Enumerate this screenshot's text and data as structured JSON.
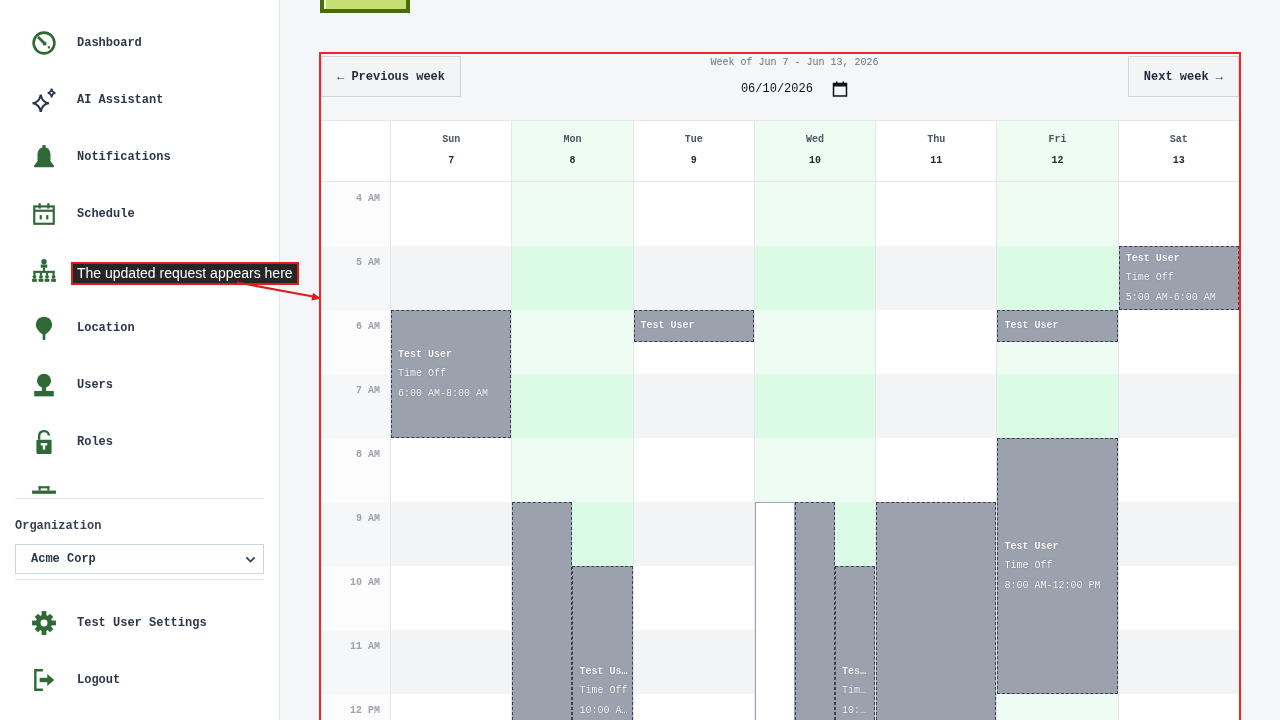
{
  "sidebar": {
    "items": [
      {
        "kind": "link",
        "label": "Dashboard"
      },
      {
        "kind": "link",
        "label": "AI Assistant"
      },
      {
        "kind": "link",
        "label": "Notifications"
      },
      {
        "kind": "link",
        "label": "Schedule"
      },
      {
        "kind": "covered"
      },
      {
        "kind": "link",
        "label": "Location"
      },
      {
        "kind": "link",
        "label": "Users"
      },
      {
        "kind": "link",
        "label": "Roles"
      },
      {
        "kind": "clipped"
      }
    ],
    "organization": {
      "label": "Organization",
      "value": "Acme Corp"
    },
    "footer_items": [
      {
        "label": "Test User Settings"
      },
      {
        "label": "Logout"
      }
    ]
  },
  "calendar": {
    "prev_button": "← Previous week",
    "title": "Week of Jun 7 - Jun 13, 2026",
    "date": "06/10/2026",
    "next_button": "Next week →",
    "hours": [
      "4 AM",
      "5 AM",
      "6 AM",
      "7 AM",
      "8 AM",
      "9 AM",
      "10 AM",
      "11 AM",
      "12 PM"
    ],
    "days": [
      {
        "name": "Sun",
        "number": "7",
        "available": false,
        "lanes": [
          [
            {
              "kind": "free"
            },
            {
              "kind": "free"
            },
            {
              "kind": "free"
            },
            {
              "kind": "free"
            },
            {
              "kind": "time_off",
              "name": "Test User",
              "type": "Time Off",
              "time": "6:00 AM-8:00 AM"
            },
            {
              "kind": "time_off"
            },
            {
              "kind": "time_off"
            },
            {
              "kind": "time_off"
            }
          ]
        ]
      },
      {
        "name": "Mon",
        "number": "8",
        "available": true,
        "lanes": [
          [
            {
              "kind": "free"
            },
            {
              "kind": "free"
            },
            {
              "kind": "free"
            },
            {
              "kind": "free"
            },
            {
              "kind": "free"
            },
            {
              "kind": "free"
            },
            {
              "kind": "free"
            },
            {
              "kind": "free"
            },
            {
              "kind": "free"
            },
            {
              "kind": "free"
            },
            {
              "kind": "time_off"
            },
            {
              "kind": "time_off"
            },
            {
              "kind": "time_off"
            },
            {
              "kind": "time_off"
            },
            {
              "kind": "time_off"
            },
            {
              "kind": "time_off"
            },
            {
              "kind": "time_off"
            }
          ],
          [
            {
              "kind": "free"
            },
            {
              "kind": "free"
            },
            {
              "kind": "free"
            },
            {
              "kind": "free"
            },
            {
              "kind": "free"
            },
            {
              "kind": "free"
            },
            {
              "kind": "free"
            },
            {
              "kind": "free"
            },
            {
              "kind": "free"
            },
            {
              "kind": "free"
            },
            {
              "kind": "free"
            },
            {
              "kind": "free"
            },
            {
              "kind": "time_off",
              "name": "Test Us…",
              "type": "Time Off",
              "time": "10:00 A…"
            },
            {
              "kind": "time_off"
            },
            {
              "kind": "time_off"
            },
            {
              "kind": "time_off"
            },
            {
              "kind": "time_off"
            }
          ]
        ]
      },
      {
        "name": "Tue",
        "number": "9",
        "available": false,
        "lanes": [
          [
            {
              "kind": "free"
            },
            {
              "kind": "free"
            },
            {
              "kind": "free"
            },
            {
              "kind": "free"
            },
            {
              "kind": "time_off",
              "name": "Test User"
            }
          ]
        ]
      },
      {
        "name": "Wed",
        "number": "10",
        "available": true,
        "lanes": [
          [
            {
              "kind": "free"
            },
            {
              "kind": "free"
            },
            {
              "kind": "free"
            },
            {
              "kind": "free"
            },
            {
              "kind": "free"
            },
            {
              "kind": "free"
            },
            {
              "kind": "free"
            },
            {
              "kind": "free"
            },
            {
              "kind": "free"
            },
            {
              "kind": "free"
            },
            {
              "kind": "outline"
            },
            {
              "kind": "outline"
            },
            {
              "kind": "outline"
            },
            {
              "kind": "outline"
            },
            {
              "kind": "outline"
            },
            {
              "kind": "outline"
            },
            {
              "kind": "outline"
            }
          ],
          [
            {
              "kind": "free"
            },
            {
              "kind": "free"
            },
            {
              "kind": "free"
            },
            {
              "kind": "free"
            },
            {
              "kind": "free"
            },
            {
              "kind": "free"
            },
            {
              "kind": "free"
            },
            {
              "kind": "free"
            },
            {
              "kind": "free"
            },
            {
              "kind": "free"
            },
            {
              "kind": "time_off"
            },
            {
              "kind": "time_off"
            },
            {
              "kind": "time_off"
            },
            {
              "kind": "time_off"
            },
            {
              "kind": "time_off"
            },
            {
              "kind": "time_off"
            },
            {
              "kind": "time_off"
            }
          ],
          [
            {
              "kind": "free"
            },
            {
              "kind": "free"
            },
            {
              "kind": "free"
            },
            {
              "kind": "free"
            },
            {
              "kind": "free"
            },
            {
              "kind": "free"
            },
            {
              "kind": "free"
            },
            {
              "kind": "free"
            },
            {
              "kind": "free"
            },
            {
              "kind": "free"
            },
            {
              "kind": "free"
            },
            {
              "kind": "free"
            },
            {
              "kind": "time_off",
              "name": "Tes…",
              "type": "Tim…",
              "time": "10:…"
            },
            {
              "kind": "time_off"
            },
            {
              "kind": "time_off"
            },
            {
              "kind": "time_off"
            },
            {
              "kind": "time_off"
            }
          ]
        ]
      },
      {
        "name": "Thu",
        "number": "11",
        "available": false,
        "lanes": [
          [
            {
              "kind": "free"
            },
            {
              "kind": "free"
            },
            {
              "kind": "free"
            },
            {
              "kind": "free"
            },
            {
              "kind": "free"
            },
            {
              "kind": "free"
            },
            {
              "kind": "free"
            },
            {
              "kind": "free"
            },
            {
              "kind": "free"
            },
            {
              "kind": "free"
            },
            {
              "kind": "time_off"
            },
            {
              "kind": "time_off"
            },
            {
              "kind": "time_off"
            },
            {
              "kind": "time_off"
            },
            {
              "kind": "time_off"
            },
            {
              "kind": "time_off"
            },
            {
              "kind": "time_off"
            }
          ]
        ]
      },
      {
        "name": "Fri",
        "number": "12",
        "available": true,
        "lanes": [
          [
            {
              "kind": "free"
            },
            {
              "kind": "free"
            },
            {
              "kind": "free"
            },
            {
              "kind": "free"
            },
            {
              "kind": "time_off",
              "name": "Test User"
            },
            {
              "kind": "free"
            },
            {
              "kind": "free"
            },
            {
              "kind": "free"
            },
            {
              "kind": "time_off",
              "name": "Test User",
              "type": "Time Off",
              "time": "8:00 AM-12:00 PM"
            },
            {
              "kind": "time_off"
            },
            {
              "kind": "time_off"
            },
            {
              "kind": "time_off"
            },
            {
              "kind": "time_off"
            },
            {
              "kind": "time_off"
            },
            {
              "kind": "time_off"
            },
            {
              "kind": "time_off"
            }
          ]
        ]
      },
      {
        "name": "Sat",
        "number": "13",
        "available": false,
        "lanes": [
          [
            {
              "kind": "free"
            },
            {
              "kind": "free"
            },
            {
              "kind": "time_off",
              "name": "Test User",
              "type": "Time Off",
              "time": "5:00 AM-6:00 AM"
            },
            {
              "kind": "time_off"
            }
          ]
        ]
      }
    ]
  },
  "annotation": {
    "callout": "The updated request appears here",
    "highlight": true
  }
}
